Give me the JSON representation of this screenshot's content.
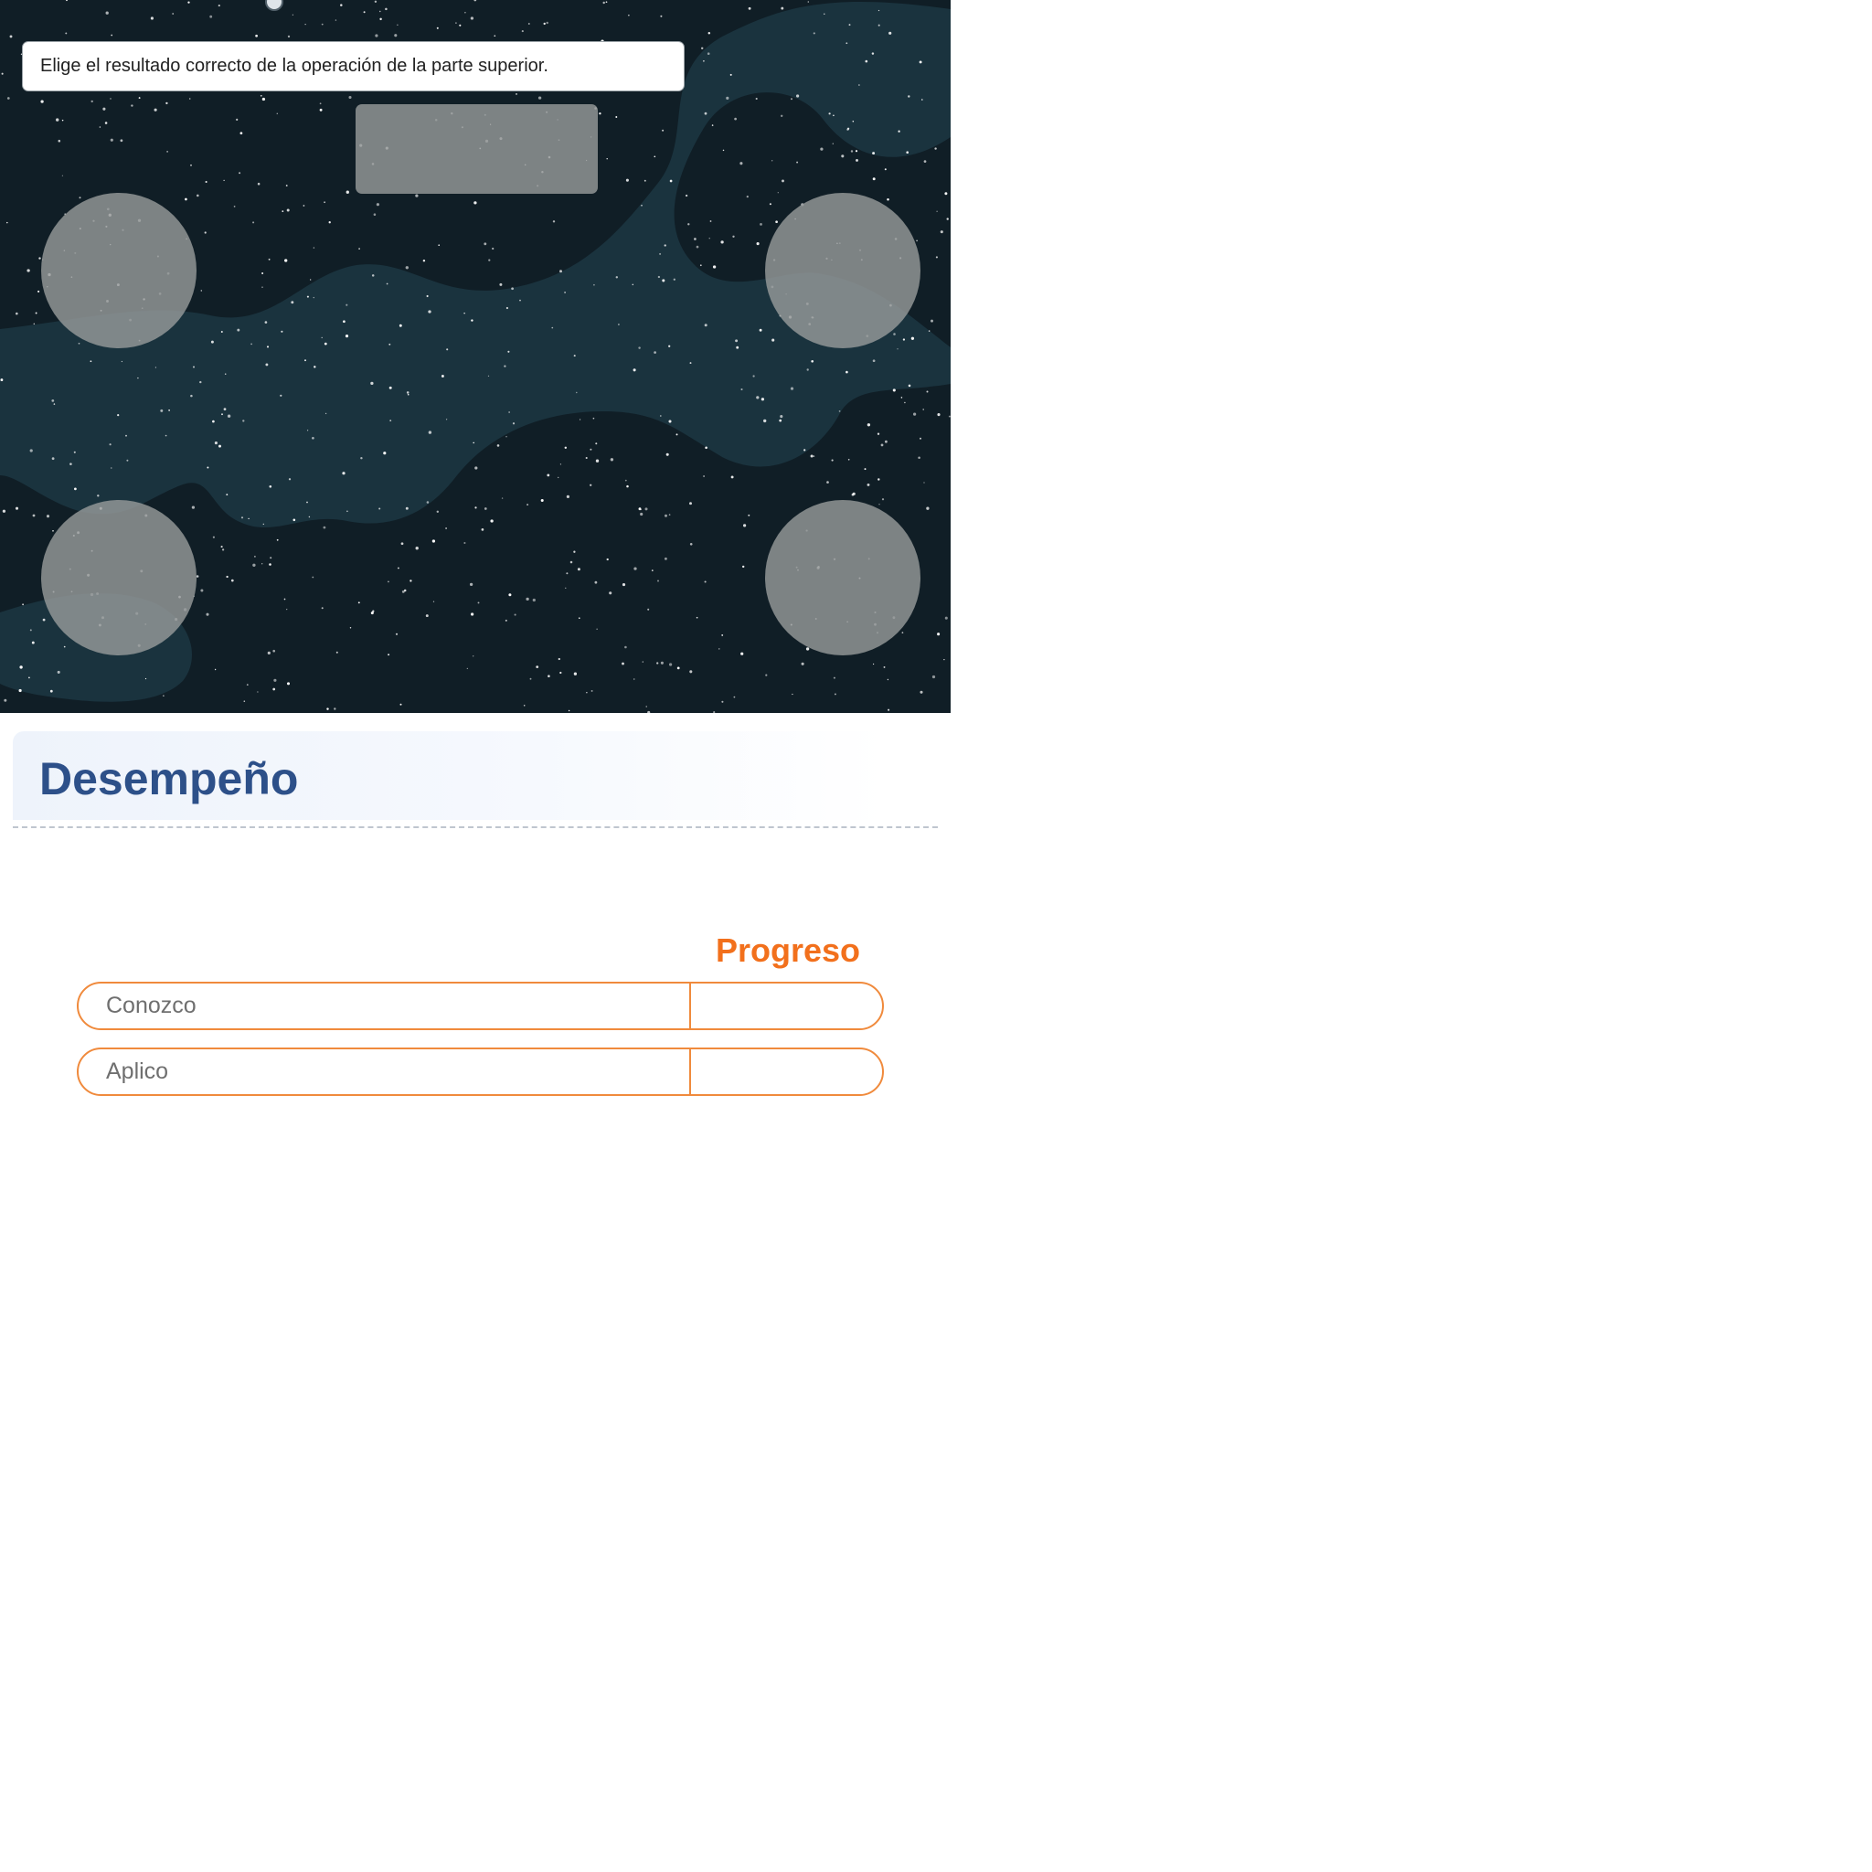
{
  "activity": {
    "instruction": "Elige el resultado correcto de la operación de la parte superior.",
    "operation_text": "",
    "answers": [
      "",
      "",
      "",
      ""
    ]
  },
  "performance": {
    "title": "Desempeño",
    "progress_heading": "Progreso",
    "rows": [
      {
        "label": "Conozco",
        "value": ""
      },
      {
        "label": "Aplico",
        "value": ""
      }
    ]
  },
  "colors": {
    "space_background": "#101e26",
    "nebula": "#1a333e",
    "placeholder_shape": "#969a9a",
    "title_blue": "#2d5089",
    "progress_orange": "#f2701c"
  }
}
